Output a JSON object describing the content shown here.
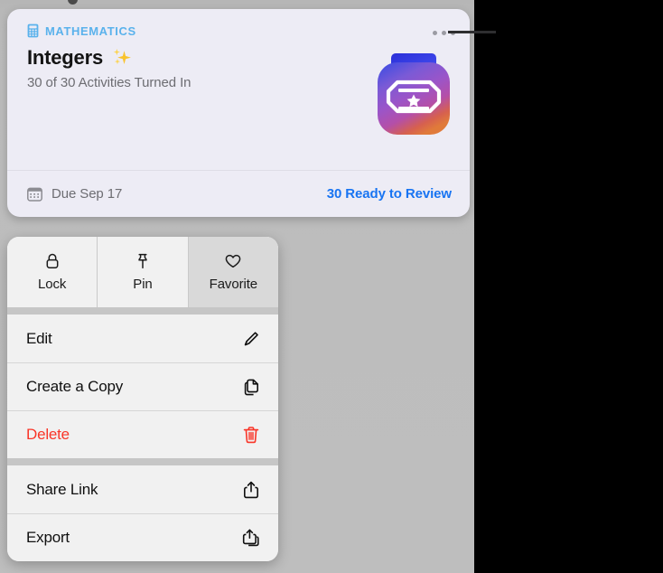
{
  "colors": {
    "accent_blue": "#1874f2",
    "subject_blue": "#5ab2ec",
    "destructive_red": "#f93528",
    "card_background": "#edecf5",
    "menu_background": "#f1f1f1",
    "backdrop_gray": "#bcbcbc",
    "secondary_text": "#6d6d72"
  },
  "card": {
    "subject_icon": "calculator-icon",
    "subject": "MATHEMATICS",
    "title": "Integers",
    "title_emoji": "✨",
    "progress": "30 of 30 Activities Turned In",
    "app_icon": "schoolwork-app-icon",
    "more_button": "ellipsis-icon",
    "footer": {
      "due_icon": "calendar-icon",
      "due": "Due Sep 17",
      "review": "30 Ready to Review"
    }
  },
  "menu": {
    "quick_actions": [
      {
        "label": "Lock",
        "icon": "lock-icon",
        "active": false
      },
      {
        "label": "Pin",
        "icon": "pin-icon",
        "active": false
      },
      {
        "label": "Favorite",
        "icon": "heart-icon",
        "active": true
      }
    ],
    "groups": [
      {
        "items": [
          {
            "label": "Edit",
            "icon": "pencil-icon",
            "destructive": false
          },
          {
            "label": "Create a Copy",
            "icon": "duplicate-icon",
            "destructive": false
          },
          {
            "label": "Delete",
            "icon": "trash-icon",
            "destructive": true
          }
        ]
      },
      {
        "items": [
          {
            "label": "Share Link",
            "icon": "share-icon",
            "destructive": false
          },
          {
            "label": "Export",
            "icon": "export-icon",
            "destructive": false
          }
        ]
      }
    ]
  }
}
